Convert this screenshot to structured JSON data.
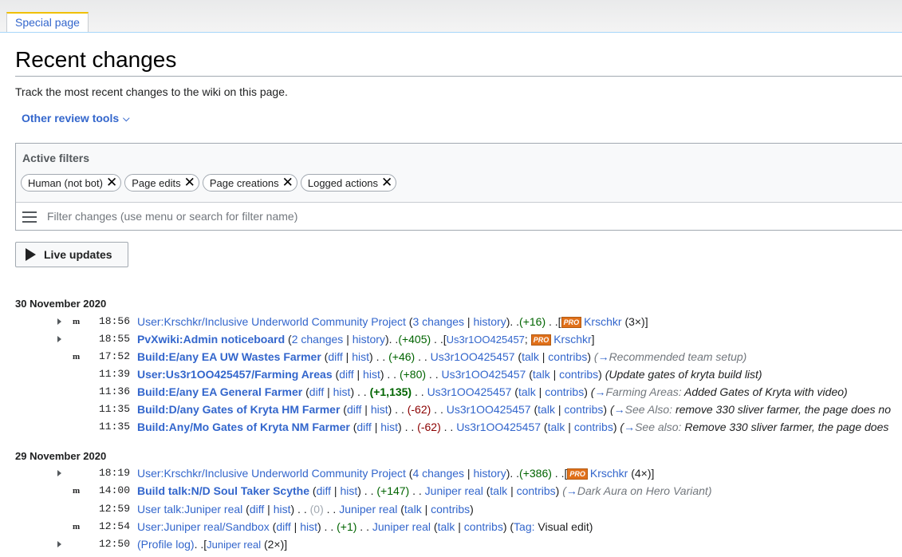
{
  "tab": {
    "label": "Special page"
  },
  "page": {
    "title": "Recent changes",
    "description": "Track the most recent changes to the wiki on this page.",
    "review_tools": "Other review tools"
  },
  "filters": {
    "active_label": "Active filters",
    "chips": [
      "Human (not bot)",
      "Page edits",
      "Page creations",
      "Logged actions"
    ],
    "search_placeholder": "Filter changes (use menu or search for filter name)",
    "live_updates": "Live updates"
  },
  "days": [
    {
      "date": "30 November 2020",
      "rows": [
        {
          "time": "18:56",
          "page": "User:Krschkr/Inclusive Underworld Community Project",
          "changes": "3 changes",
          "history": "history",
          "size": "(+16)",
          "user": "Krschkr",
          "count": "(3×)"
        },
        {
          "time": "18:55",
          "page": "PvXwiki:Admin noticeboard",
          "changes": "2 changes",
          "history": "history",
          "size": "(+405)",
          "user1": "Us3r1OO425457",
          "user2": "Krschkr"
        },
        {
          "time": "17:52",
          "page": "Build:E/any EA UW Wastes Farmer",
          "size": "(+46)",
          "user": "Us3r1OO425457",
          "comment_section": "Recommended team setup"
        },
        {
          "time": "11:39",
          "page": "User:Us3r1OO425457/Farming Areas",
          "size": "(+80)",
          "user": "Us3r1OO425457",
          "comment": "(Update gates of kryta build list)"
        },
        {
          "time": "11:36",
          "page": "Build:E/any EA General Farmer",
          "size": "(+1,135)",
          "user": "Us3r1OO425457",
          "comment_section": "Farming Areas:",
          "comment": "Added Gates of Kryta with video)"
        },
        {
          "time": "11:35",
          "page": "Build:D/any Gates of Kryta HM Farmer",
          "size": "(-62)",
          "user": "Us3r1OO425457",
          "comment_section": "See Also:",
          "comment": "remove 330 sliver farmer, the page does no"
        },
        {
          "time": "11:35",
          "page": "Build:Any/Mo Gates of Kryta NM Farmer",
          "size": "(-62)",
          "user": "Us3r1OO425457",
          "comment_section": "See also:",
          "comment": "Remove 330 sliver farmer, the page does"
        }
      ]
    },
    {
      "date": "29 November 2020",
      "rows": [
        {
          "time": "18:19",
          "page": "User:Krschkr/Inclusive Underworld Community Project",
          "changes": "4 changes",
          "history": "history",
          "size": "(+386)",
          "user": "Krschkr",
          "count": "(4×)"
        },
        {
          "time": "14:00",
          "page": "Build talk:N/D Soul Taker Scythe",
          "size": "(+147)",
          "user": "Juniper real",
          "comment_section": "Dark Aura on Hero Variant"
        },
        {
          "time": "12:59",
          "page": "User talk:Juniper real",
          "size": "(0)",
          "user": "Juniper real"
        },
        {
          "time": "12:54",
          "page": "User:Juniper real/Sandbox",
          "size": "(+1)",
          "user": "Juniper real",
          "tag_label": "Tag:",
          "tag": "Visual edit"
        },
        {
          "time": "12:50",
          "page": "(Profile log)",
          "user": "Juniper real",
          "count": "(2×)"
        }
      ]
    }
  ],
  "labels": {
    "diff": "diff",
    "hist": "hist",
    "talk": "talk",
    "contribs": "contribs",
    "minor": "m",
    "pro": "PRO",
    "arrow": "→"
  }
}
